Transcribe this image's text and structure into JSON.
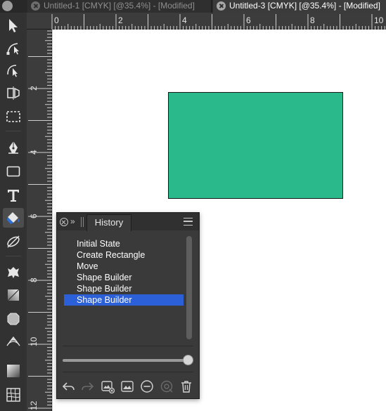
{
  "tabs": [
    {
      "title": "Untitled-1 [CMYK] [@35.4%] - [Modified]",
      "active": false
    },
    {
      "title": "Untitled-3 [CMYK] [@35.4%] - [Modified]",
      "active": true
    }
  ],
  "toolbar": {
    "tools": [
      {
        "name": "move-tool",
        "icon": "arrow-pointer-icon"
      },
      {
        "name": "node-tool",
        "icon": "node-pointer-icon"
      },
      {
        "name": "corner-tool",
        "icon": "corner-icon"
      },
      {
        "name": "transform-tool",
        "icon": "transform-icon"
      },
      {
        "name": "marquee-tool",
        "icon": "marquee-icon"
      },
      {
        "name": "pen-tool",
        "icon": "pen-icon"
      },
      {
        "name": "rectangle-tool",
        "icon": "rectangle-icon"
      },
      {
        "name": "text-tool",
        "icon": "text-icon"
      },
      {
        "name": "fill-tool",
        "icon": "paint-bucket-icon",
        "active": true
      },
      {
        "name": "transparency-tool",
        "icon": "transparency-icon"
      },
      {
        "name": "place-tool",
        "icon": "place-icon"
      },
      {
        "name": "gradient-tool",
        "icon": "gradient-icon"
      },
      {
        "name": "shape-tool",
        "icon": "shape-icon"
      },
      {
        "name": "perspective-tool",
        "icon": "perspective-icon"
      },
      {
        "name": "swatch-tool",
        "icon": "swatch-icon"
      },
      {
        "name": "mesh-tool",
        "icon": "mesh-icon"
      }
    ]
  },
  "ruler": {
    "horizontal_labels": [
      "0",
      "2",
      "4",
      "6",
      "8",
      "10"
    ],
    "vertical_labels": [
      "2",
      "4",
      "6",
      "8",
      "10",
      "12"
    ]
  },
  "canvas": {
    "shape_fill": "#2ab98a",
    "shape_stroke": "#1a1a1a"
  },
  "history_panel": {
    "tab_label": "History",
    "items": [
      "Initial State",
      "Create Rectangle",
      "Move",
      "Shape Builder",
      "Shape Builder",
      "Shape Builder"
    ],
    "selected_index": 5,
    "slider_position": 1.0,
    "selection_color": "#2c60d8",
    "buttons": [
      {
        "name": "undo-button",
        "icon": "undo-icon"
      },
      {
        "name": "redo-button",
        "icon": "redo-icon"
      },
      {
        "name": "snapshot-delete-button",
        "icon": "snapshot-delete-icon"
      },
      {
        "name": "snapshot-button",
        "icon": "snapshot-icon"
      },
      {
        "name": "remove-button",
        "icon": "minus-circle-icon"
      },
      {
        "name": "target-button",
        "icon": "target-icon"
      },
      {
        "name": "delete-button",
        "icon": "trash-icon"
      }
    ]
  }
}
